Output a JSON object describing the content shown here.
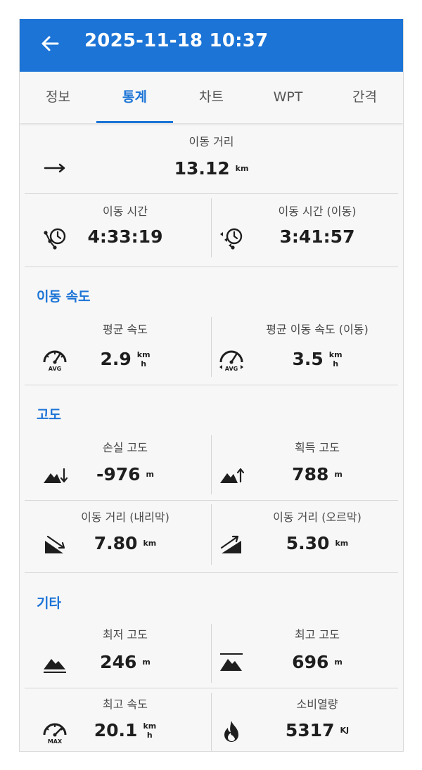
{
  "header": {
    "title": "2025-11-18 10:37"
  },
  "tabs": [
    "정보",
    "통계",
    "차트",
    "WPT",
    "간격"
  ],
  "distance": {
    "label": "이동 거리",
    "value": "13.12",
    "unit": "km"
  },
  "time": {
    "total": {
      "label": "이동 시간",
      "value": "4:33:19"
    },
    "moving": {
      "label": "이동 시간 (이동)",
      "value": "3:41:57"
    }
  },
  "speed_section": {
    "title": "이동 속도",
    "avg": {
      "label": "평균 속도",
      "value": "2.9",
      "unit_top": "km",
      "unit_bottom": "h",
      "icon_text": "AVG"
    },
    "avg_moving": {
      "label": "평균 이동 속도 (이동)",
      "value": "3.5",
      "unit_top": "km",
      "unit_bottom": "h",
      "icon_text": "AVG"
    }
  },
  "altitude_section": {
    "title": "고도",
    "loss": {
      "label": "손실 고도",
      "value": "-976",
      "unit": "m"
    },
    "gain": {
      "label": "획득 고도",
      "value": "788",
      "unit": "m"
    },
    "downhill": {
      "label": "이동 거리 (내리막)",
      "value": "7.80",
      "unit": "km"
    },
    "uphill": {
      "label": "이동 거리 (오르막)",
      "value": "5.30",
      "unit": "km"
    }
  },
  "other_section": {
    "title": "기타",
    "min_alt": {
      "label": "최저 고도",
      "value": "246",
      "unit": "m"
    },
    "max_alt": {
      "label": "최고 고도",
      "value": "696",
      "unit": "m"
    },
    "max_speed": {
      "label": "최고 속도",
      "value": "20.1",
      "unit_top": "km",
      "unit_bottom": "h",
      "icon_text": "MAX"
    },
    "calories": {
      "label": "소비열량",
      "value": "5317",
      "unit": "KJ"
    }
  },
  "colors": {
    "accent": "#1c74d6",
    "text": "#1e1e1e",
    "background": "#f7f7f7"
  }
}
